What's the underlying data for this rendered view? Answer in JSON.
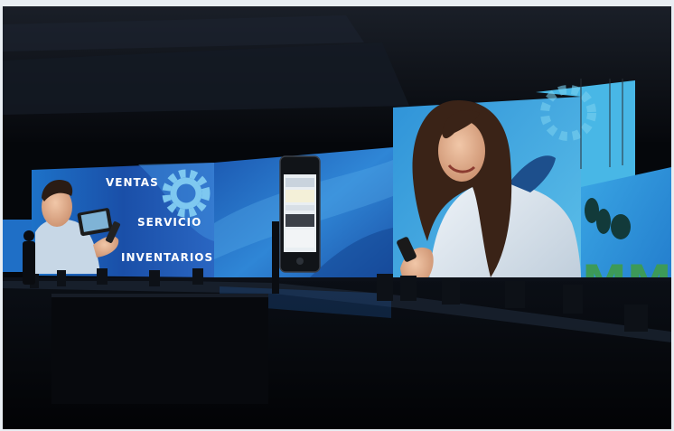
{
  "scene": {
    "left_screen": {
      "labels": [
        "VENTAS",
        "SERVICIO",
        "INVENTARIOS"
      ]
    },
    "phone_screen": {
      "visible_text": ""
    },
    "right_screen": {
      "logo_text": "MM"
    },
    "colors": {
      "screen_blue": "#1e63b8",
      "screen_cyan": "#3fb3e6",
      "logo_green": "#3d9a58",
      "background": "#05070b"
    }
  }
}
